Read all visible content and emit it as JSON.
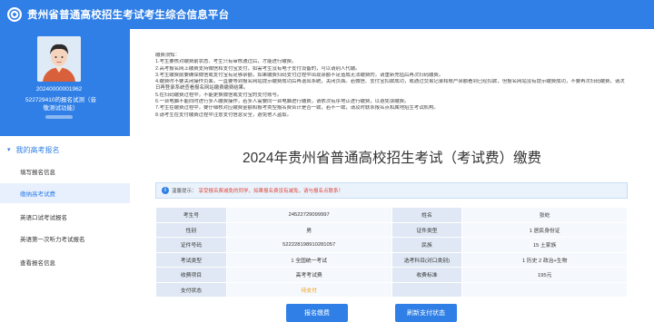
{
  "app": {
    "title": "贵州省普通高校招生考试考生综合信息平台"
  },
  "profile": {
    "id": "20240000001962",
    "name_line": "522729410的报名试测（音",
    "name_line2": "敬测试功能）"
  },
  "sidebar": {
    "group_label": "我的高考报名",
    "items": [
      {
        "label": "填写报名信息"
      },
      {
        "label": "缴纳高考试费"
      },
      {
        "label": "英语口试考试报名"
      },
      {
        "label": "英语第一次听力考试报名"
      },
      {
        "label": "查看报名信息"
      }
    ]
  },
  "notice": {
    "lines": [
      "缴费须知：",
      "1.考生要核对缴费前状态、考生只有审核通过后，才能进行缴费。",
      "2.高考报名网上缴费支持微信和支付宝支付，如需考生没有电子支付设备的，可以请别人代缴。",
      "3.考生缴费前要确保微信或支付宝有足够余额，如果缴费扫码支付过程中出现余额不足造成无法缴费的，请重新充值后再次扫码缴费。",
      "4.缴费时不要关闭操作页面，一直要等到报名网站提示缴费成功后再退出系统，关闭页面。若微信、支付宝扣款成功，或通过交易记录和账户余额看到已经扣款，但报名网站没有提示缴费成功，不要再次扫码缴费，请次日再登录系统查看报名网站缴费缴费结果。",
      "5.在扫码缴费过程中，不能更换微信或支付宝的支付账号。",
      "6.一台电脑不能同时进行多人缴费操作，若多人需要同一台电脑进行缴费，请依次有序地认进行缴费，以避免误缴费。",
      "7.考生在缴费过程中，要仔细核对应缴费金额和报考类型报名费合计是否一致，若不一致，请及时联系报名点和属地招生考试机构。",
      "8.请考生在支付缴费过程中注意支付信息安全，避免他人盗取。"
    ]
  },
  "page": {
    "heading": "2024年贵州省普通高校招生考试（考试费）缴费"
  },
  "hint": {
    "prefix": "温馨提示：",
    "text": "享受报名费减免的同学，如果报名费没有减免，请与报名点联系！"
  },
  "table": {
    "rows": [
      [
        "考生号",
        "24522729099997",
        "姓名",
        "张屹"
      ],
      [
        "性别",
        "男",
        "证件类型",
        "1 居民身份证"
      ],
      [
        "证件号码",
        "522228198910281057",
        "民族",
        "15 土家族"
      ],
      [
        "考试类型",
        "1 全国统一考试",
        "选考科目(对口类别)",
        "1 历史 2 政治+生物"
      ],
      [
        "收费项目",
        "高考考试费",
        "收费标准",
        "195元"
      ],
      [
        "支付状态",
        "待支付",
        "",
        ""
      ]
    ]
  },
  "buttons": {
    "pay": "报名缴费",
    "refresh": "刷新支付状态"
  },
  "colors": {
    "brand": "#2f7fe6",
    "pending": "#f39c12",
    "alert": "#e0463a"
  }
}
